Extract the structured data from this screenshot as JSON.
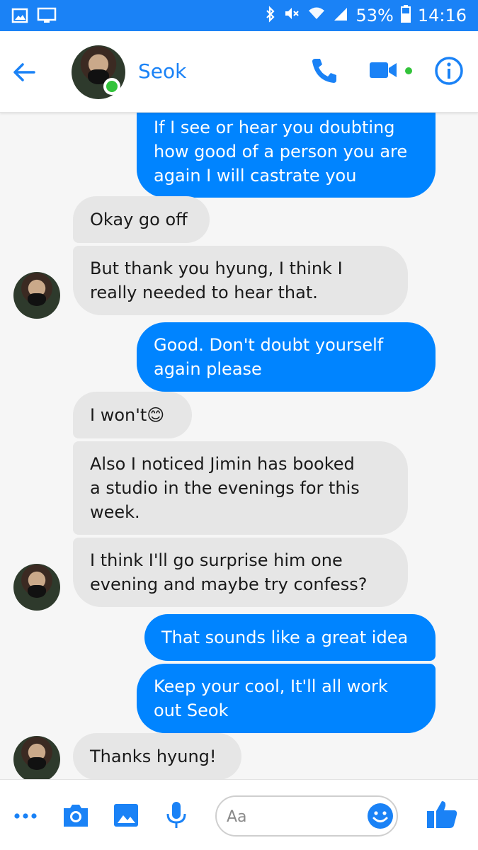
{
  "status_bar": {
    "battery": "53%",
    "time": "14:16",
    "icons": [
      "image-icon",
      "screen-icon",
      "bluetooth-icon",
      "mute-icon",
      "wifi-icon",
      "signal-icon",
      "battery-icon"
    ]
  },
  "header": {
    "contact_name": "Seok",
    "online": true,
    "icons": [
      "back-arrow-icon",
      "phone-icon",
      "video-camera-icon",
      "info-icon"
    ]
  },
  "messages": [
    {
      "dir": "out",
      "text": "If I see or hear you doubting\nhow good of a person you are\nagain I will castrate you"
    },
    {
      "dir": "in",
      "text": "Okay go off"
    },
    {
      "dir": "in",
      "text": "But thank you hyung, I think I\nreally needed to hear that."
    },
    {
      "dir": "out",
      "text": "Good. Don't doubt yourself\nagain please"
    },
    {
      "dir": "in",
      "text": "I won't😊"
    },
    {
      "dir": "in",
      "text": "Also I noticed Jimin has booked\na studio in the evenings for this\nweek."
    },
    {
      "dir": "in",
      "text": "I think I'll go surprise him one\nevening and maybe try confess?"
    },
    {
      "dir": "out",
      "text": "That sounds like a great idea"
    },
    {
      "dir": "out",
      "text": "Keep your cool, It'll all work\nout Seok"
    },
    {
      "dir": "in",
      "text": "Thanks hyung!"
    }
  ],
  "composer": {
    "placeholder": "Aa",
    "icons": [
      "more-icon",
      "camera-icon",
      "gallery-icon",
      "microphone-icon",
      "emoji-icon",
      "thumbs-up-icon"
    ]
  },
  "colors": {
    "accent": "#1a82f6",
    "outgoing_bubble": "#0084ff",
    "incoming_bubble": "#e6e6e6",
    "online": "#32c33a"
  }
}
